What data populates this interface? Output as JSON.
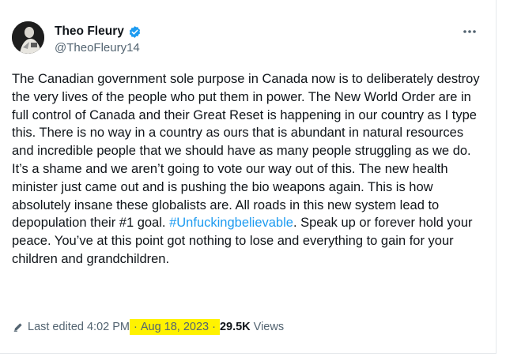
{
  "author": {
    "display_name": "Theo Fleury",
    "handle": "@TheoFleury14",
    "verified_icon": "verified-badge-icon",
    "verified_color": "#1d9bf0"
  },
  "more_icon": "more-horizontal-icon",
  "tweet": {
    "text_before_hashtag": "The Canadian government sole purpose in Canada now is to deliberately destroy the very lives of the people who put them in power. The New World Order are in full control of Canada and their Great Reset is happening in our country as I type this. There is no way in a country as ours that is abundant in natural resources and incredible people that we should have as many people struggling as we do. It’s a shame and we aren’t going to vote our way out of this. The new health minister just came out and is pushing the bio weapons again. This is how absolutely insane these globalists are. All roads in this new system lead to depopulation their #1 goal.",
    "hashtag": "#Unfuckingbelievable",
    "text_after_hashtag": ". Speak up or forever hold your peace. You’ve at this point got nothing to lose and everything to gain for your children and grandchildren.",
    "hashtag_color": "#1d9bf0"
  },
  "meta": {
    "edit_icon": "pencil-icon",
    "edited_label": "Last edited 4:02 PM",
    "separator": "·",
    "date": "Aug 18, 2023",
    "views_count": "29.5K",
    "views_label": "Views",
    "highlight_color": "#fff200"
  }
}
